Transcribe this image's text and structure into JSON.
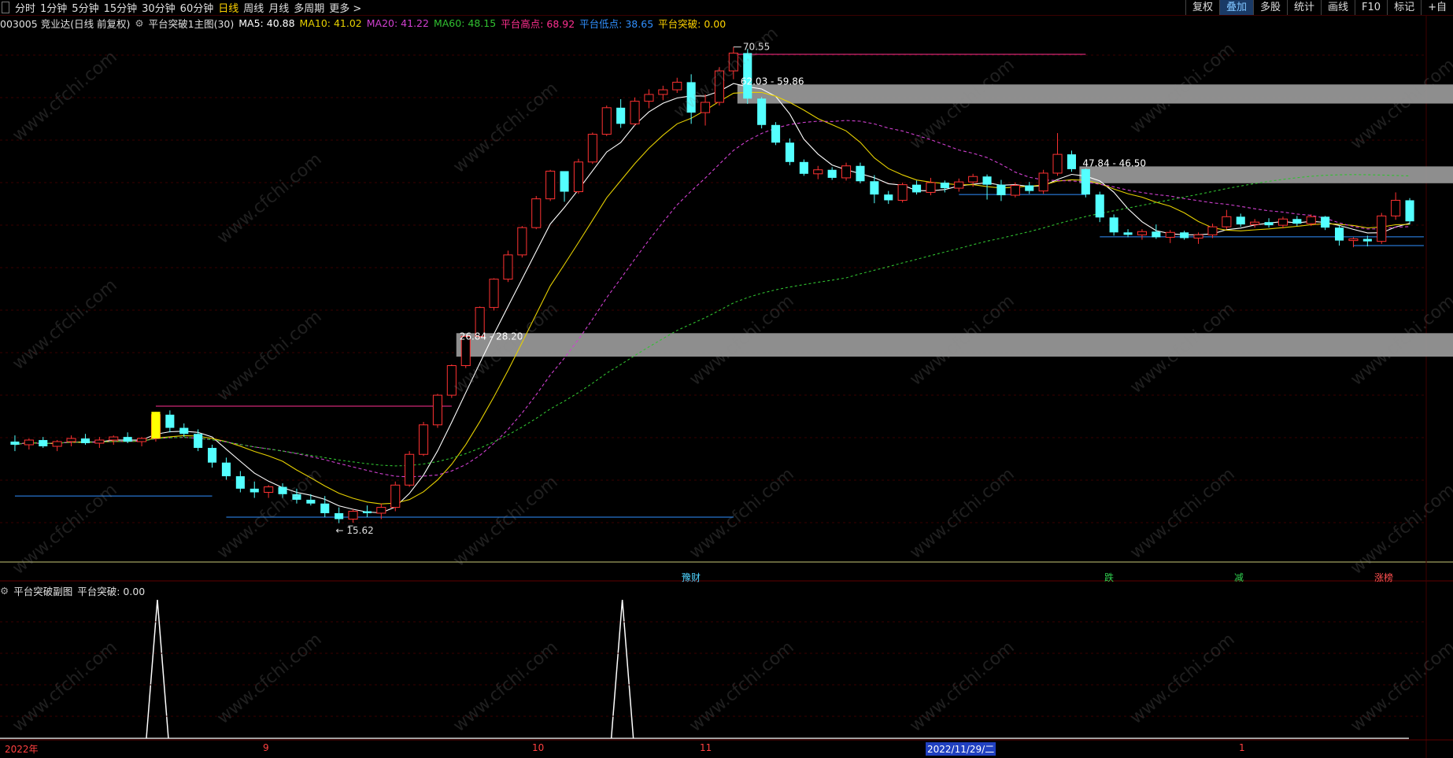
{
  "toolbar": {
    "periods": [
      "分时",
      "1分钟",
      "5分钟",
      "15分钟",
      "30分钟",
      "60分钟",
      "日线",
      "周线",
      "月线",
      "多周期",
      "更多 >"
    ],
    "active_period": "日线",
    "right_buttons": [
      "复权",
      "叠加",
      "多股",
      "统计",
      "画线",
      "F10",
      "标记",
      "+自"
    ]
  },
  "info": {
    "stock": "003005 竞业达(日线 前复权)",
    "indicator": "平台突破1主图(30)",
    "ma5": "MA5: 40.88",
    "ma10": "MA10: 41.02",
    "ma20": "MA20: 41.22",
    "ma60": "MA60: 48.15",
    "platform_high": "平台高点: 68.92",
    "platform_low": "平台低点: 38.65",
    "platform_break": "平台突破: 0.00"
  },
  "sub": {
    "title": "平台突破副图",
    "value": "平台突破: 0.00"
  },
  "annotations": {
    "max_price": "70.55",
    "min_price": "15.62",
    "zone1": "62.03 - 59.86",
    "zone2": "47.84 - 46.50",
    "zone3": "26.84 - 28.20"
  },
  "events": [
    {
      "text": "豫财",
      "color": "#4fd4ff"
    },
    {
      "text": "跌",
      "color": "#30d050"
    },
    {
      "text": "减",
      "color": "#30d050"
    },
    {
      "text": "涨榜",
      "color": "#ff5050"
    }
  ],
  "dates": [
    "2022年",
    "9",
    "10",
    "11",
    "2022/11/29/二",
    "1"
  ],
  "watermark": "www.cfchi.com",
  "colors": {
    "up": "#ff3232",
    "down": "#54ffff",
    "ma5": "#ffffff",
    "ma10": "#e6d000",
    "ma20": "#d040d0",
    "ma60": "#30c030",
    "platform_high": "#ff3090",
    "platform_low": "#3090ff"
  },
  "chart_data": {
    "type": "candlestick",
    "ylim": [
      14,
      73
    ],
    "candles": [
      [
        20.2,
        20.6,
        19.6,
        20.0
      ],
      [
        20.0,
        20.4,
        19.7,
        20.3
      ],
      [
        20.3,
        20.5,
        19.8,
        19.9
      ],
      [
        19.9,
        20.3,
        19.6,
        20.2
      ],
      [
        20.2,
        20.6,
        19.9,
        20.4
      ],
      [
        20.4,
        20.7,
        20.0,
        20.1
      ],
      [
        20.1,
        20.5,
        19.8,
        20.3
      ],
      [
        20.3,
        20.6,
        20.0,
        20.5
      ],
      [
        20.5,
        20.8,
        20.1,
        20.2
      ],
      [
        20.2,
        20.5,
        19.9,
        20.4
      ],
      [
        20.4,
        22.2,
        20.2,
        22.0
      ],
      [
        22.0,
        22.3,
        20.8,
        21.1
      ],
      [
        21.1,
        21.4,
        20.5,
        20.7
      ],
      [
        20.7,
        21.0,
        19.6,
        19.8
      ],
      [
        19.8,
        20.0,
        18.6,
        18.9
      ],
      [
        18.9,
        19.2,
        17.9,
        18.1
      ],
      [
        18.1,
        18.4,
        17.2,
        17.4
      ],
      [
        17.4,
        17.8,
        16.9,
        17.2
      ],
      [
        17.2,
        17.6,
        16.9,
        17.5
      ],
      [
        17.5,
        17.7,
        16.9,
        17.1
      ],
      [
        17.1,
        17.4,
        16.6,
        16.8
      ],
      [
        16.8,
        17.1,
        16.5,
        16.6
      ],
      [
        16.6,
        17.0,
        15.9,
        16.1
      ],
      [
        16.1,
        16.4,
        15.6,
        15.8
      ],
      [
        15.8,
        16.3,
        15.62,
        16.2
      ],
      [
        16.2,
        16.5,
        15.9,
        16.1
      ],
      [
        16.1,
        16.6,
        15.8,
        16.4
      ],
      [
        16.4,
        17.8,
        16.2,
        17.6
      ],
      [
        17.6,
        19.6,
        17.5,
        19.4
      ],
      [
        19.4,
        21.5,
        19.3,
        21.3
      ],
      [
        21.3,
        23.5,
        21.1,
        23.4
      ],
      [
        23.4,
        25.8,
        23.2,
        25.7
      ],
      [
        25.7,
        28.3,
        25.5,
        28.2
      ],
      [
        28.2,
        31.0,
        28.0,
        30.9
      ],
      [
        30.9,
        33.9,
        30.6,
        33.8
      ],
      [
        33.8,
        37.0,
        33.5,
        36.5
      ],
      [
        36.5,
        40.0,
        36.2,
        39.8
      ],
      [
        39.8,
        44.0,
        39.6,
        43.6
      ],
      [
        43.6,
        47.8,
        43.3,
        47.6
      ],
      [
        47.6,
        46.5,
        43.2,
        44.6
      ],
      [
        44.6,
        49.5,
        44.3,
        49.0
      ],
      [
        49.0,
        53.8,
        48.7,
        53.5
      ],
      [
        53.5,
        58.6,
        53.2,
        58.2
      ],
      [
        58.2,
        59.8,
        54.6,
        55.3
      ],
      [
        55.3,
        60.1,
        55.0,
        59.4
      ],
      [
        59.4,
        61.7,
        58.1,
        60.7
      ],
      [
        60.7,
        62.4,
        59.6,
        61.6
      ],
      [
        61.6,
        64.0,
        61.0,
        63.1
      ],
      [
        63.1,
        64.7,
        55.3,
        57.3
      ],
      [
        57.3,
        60.7,
        55.0,
        59.2
      ],
      [
        59.2,
        66.2,
        58.6,
        65.4
      ],
      [
        65.4,
        70.55,
        63.7,
        69.2
      ],
      [
        69.2,
        70.1,
        58.9,
        59.9
      ],
      [
        59.9,
        60.2,
        54.5,
        55.1
      ],
      [
        55.1,
        55.6,
        51.7,
        52.1
      ],
      [
        52.1,
        52.8,
        48.5,
        49.0
      ],
      [
        49.0,
        49.4,
        46.9,
        47.2
      ],
      [
        47.2,
        48.4,
        46.4,
        47.8
      ],
      [
        47.8,
        48.2,
        46.3,
        46.6
      ],
      [
        46.6,
        48.9,
        46.2,
        48.4
      ],
      [
        48.4,
        48.9,
        45.8,
        46.1
      ],
      [
        46.1,
        47.0,
        43.0,
        44.2
      ],
      [
        44.2,
        44.7,
        42.9,
        43.4
      ],
      [
        43.4,
        45.9,
        43.1,
        45.6
      ],
      [
        45.6,
        46.2,
        44.2,
        44.5
      ],
      [
        44.5,
        46.6,
        44.1,
        45.9
      ],
      [
        45.9,
        46.2,
        44.5,
        45.1
      ],
      [
        45.1,
        46.5,
        44.6,
        46.0
      ],
      [
        46.0,
        47.2,
        45.3,
        46.8
      ],
      [
        46.8,
        47.1,
        43.5,
        45.6
      ],
      [
        45.6,
        46.3,
        43.3,
        44.1
      ],
      [
        44.1,
        45.9,
        43.8,
        45.5
      ],
      [
        45.5,
        46.0,
        44.3,
        44.7
      ],
      [
        44.7,
        47.8,
        44.3,
        47.3
      ],
      [
        47.3,
        53.7,
        46.9,
        50.2
      ],
      [
        50.2,
        50.8,
        47.5,
        47.9
      ],
      [
        47.9,
        48.0,
        43.8,
        44.2
      ],
      [
        44.2,
        44.6,
        40.5,
        41.1
      ],
      [
        41.1,
        41.5,
        38.8,
        39.2
      ],
      [
        39.2,
        39.6,
        38.6,
        38.9
      ],
      [
        38.9,
        39.6,
        38.3,
        39.3
      ],
      [
        39.3,
        40.2,
        38.4,
        38.6
      ],
      [
        38.6,
        39.5,
        37.9,
        39.2
      ],
      [
        39.2,
        39.4,
        38.3,
        38.5
      ],
      [
        38.5,
        39.2,
        37.8,
        38.9
      ],
      [
        38.9,
        40.3,
        38.5,
        39.9
      ],
      [
        39.9,
        42.1,
        39.6,
        41.2
      ],
      [
        41.2,
        41.6,
        39.9,
        40.2
      ],
      [
        40.2,
        40.9,
        39.8,
        40.5
      ],
      [
        40.5,
        41.0,
        39.8,
        40.1
      ],
      [
        40.1,
        41.2,
        39.7,
        40.9
      ],
      [
        40.9,
        41.3,
        40.0,
        40.3
      ],
      [
        40.3,
        41.5,
        40.0,
        41.2
      ],
      [
        41.2,
        41.3,
        39.5,
        39.8
      ],
      [
        39.8,
        40.1,
        37.6,
        38.2
      ],
      [
        38.2,
        38.6,
        37.4,
        38.4
      ],
      [
        38.4,
        38.8,
        37.5,
        38.1
      ],
      [
        38.1,
        41.7,
        37.8,
        41.3
      ],
      [
        41.3,
        44.5,
        40.8,
        43.4
      ],
      [
        43.4,
        43.7,
        40.2,
        40.6
      ]
    ],
    "platforms": [
      {
        "label": "62.03 - 59.86",
        "high": 62.03,
        "low": 59.86
      },
      {
        "label": "47.84 - 46.50",
        "high": 47.84,
        "low": 46.5
      },
      {
        "label": "26.84 - 28.20",
        "high": 28.2,
        "low": 26.84
      }
    ],
    "signals": [
      10,
      43
    ]
  }
}
